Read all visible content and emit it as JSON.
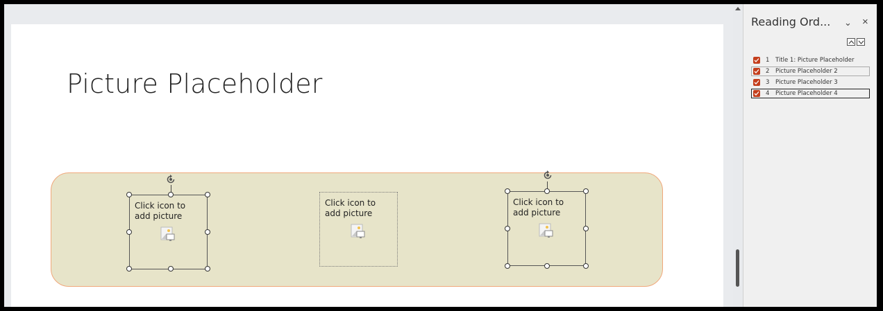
{
  "slide": {
    "title": "Picture Placeholder",
    "placeholders": [
      {
        "text": "Click icon to\nadd picture",
        "state": "selected"
      },
      {
        "text": "Click icon to\nadd picture",
        "state": "unselected"
      },
      {
        "text": "Click icon to\nadd picture",
        "state": "selected"
      }
    ]
  },
  "pane": {
    "title": "Reading Ord...",
    "items": [
      {
        "num": "1",
        "label": "Title 1: Picture Placeholder",
        "checked": true
      },
      {
        "num": "2",
        "label": "Picture Placeholder 2",
        "checked": true
      },
      {
        "num": "3",
        "label": "Picture Placeholder 3",
        "checked": true
      },
      {
        "num": "4",
        "label": "Picture Placeholder 4",
        "checked": true
      }
    ]
  },
  "icons": {
    "collapse": "chevron-down-icon",
    "close": "close-icon",
    "move_up": "move-up-icon",
    "move_down": "move-down-icon",
    "picture": "insert-picture-icon",
    "rotate": "rotate-handle-icon"
  },
  "colors": {
    "checkbox": "#c43e1c",
    "group_fill": "#e7e4c9",
    "group_border": "#f0a77a"
  }
}
